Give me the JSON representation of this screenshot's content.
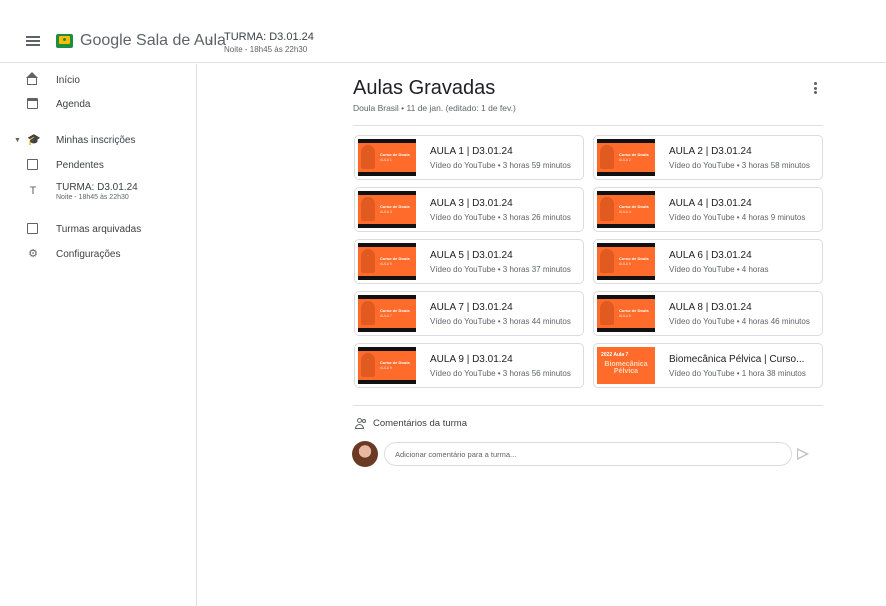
{
  "header": {
    "app_title": "Google Sala de Aula",
    "class_title": "TURMA: D3.01.24",
    "class_subtitle": "Noite - 18h45 às 22h30"
  },
  "sidebar": {
    "items": [
      {
        "label": "Início",
        "icon": "home-icon"
      },
      {
        "label": "Agenda",
        "icon": "calendar-icon"
      },
      {
        "label": "Minhas inscrições",
        "icon": "school-icon"
      },
      {
        "label": "Pendentes",
        "icon": "assignment-icon"
      },
      {
        "label": "TURMA: D3.01.24",
        "sub": "Noite - 18h45 às 22h30",
        "icon_letter": "T"
      },
      {
        "label": "Turmas arquivadas",
        "icon": "archive-icon"
      },
      {
        "label": "Configurações",
        "icon": "gear-icon"
      }
    ]
  },
  "main": {
    "title": "Aulas Gravadas",
    "meta": "Doula Brasil • 11 de jan. (editado: 1 de fev.)",
    "materials": [
      {
        "title": "AULA 1 | D3.01.24",
        "sub": "Vídeo do YouTube • 3 horas 59 minutos",
        "thumb_title": "Curso de Doula",
        "thumb_sub": "AULA 1"
      },
      {
        "title": "AULA 2 | D3.01.24",
        "sub": "Vídeo do YouTube • 3 horas 58 minutos",
        "thumb_title": "Curso de Doula",
        "thumb_sub": "AULA 2"
      },
      {
        "title": "AULA 3 | D3.01.24",
        "sub": "Vídeo do YouTube • 3 horas 26 minutos",
        "thumb_title": "Curso de Doula",
        "thumb_sub": "AULA 3"
      },
      {
        "title": "AULA 4 | D3.01.24",
        "sub": "Vídeo do YouTube • 4 horas 9 minutos",
        "thumb_title": "Curso de Doula",
        "thumb_sub": "AULA 4"
      },
      {
        "title": "AULA 5 | D3.01.24",
        "sub": "Vídeo do YouTube • 3 horas 37 minutos",
        "thumb_title": "Curso de Doula",
        "thumb_sub": "AULA 5"
      },
      {
        "title": "AULA 6 | D3.01.24",
        "sub": "Vídeo do YouTube • 4 horas",
        "thumb_title": "Curso de Doula",
        "thumb_sub": "AULA 6"
      },
      {
        "title": "AULA 7 | D3.01.24",
        "sub": "Vídeo do YouTube • 3 horas 44 minutos",
        "thumb_title": "Curso de Doula",
        "thumb_sub": "AULA 7"
      },
      {
        "title": "AULA 8 | D3.01.24",
        "sub": "Vídeo do YouTube • 4 horas 46 minutos",
        "thumb_title": "Curso de Doula",
        "thumb_sub": "AULA 8"
      },
      {
        "title": "AULA 9 | D3.01.24",
        "sub": "Vídeo do YouTube • 3 horas 56 minutos",
        "thumb_title": "Curso de Doula",
        "thumb_sub": "AULA 9"
      },
      {
        "title": "Biomecânica Pélvica | Curso...",
        "sub": "Vídeo do YouTube • 1 hora 38 minutos",
        "thumb_title": "2022 Aula 7",
        "thumb_sub": "Biomecânica Pélvica"
      }
    ],
    "comments_label": "Comentários da turma",
    "comment_placeholder": "Adicionar comentário para a turma..."
  },
  "colors": {
    "thumb_orange": "#ff6b2b",
    "logo_green": "#1e8e3e",
    "logo_yellow": "#fbbc04"
  }
}
